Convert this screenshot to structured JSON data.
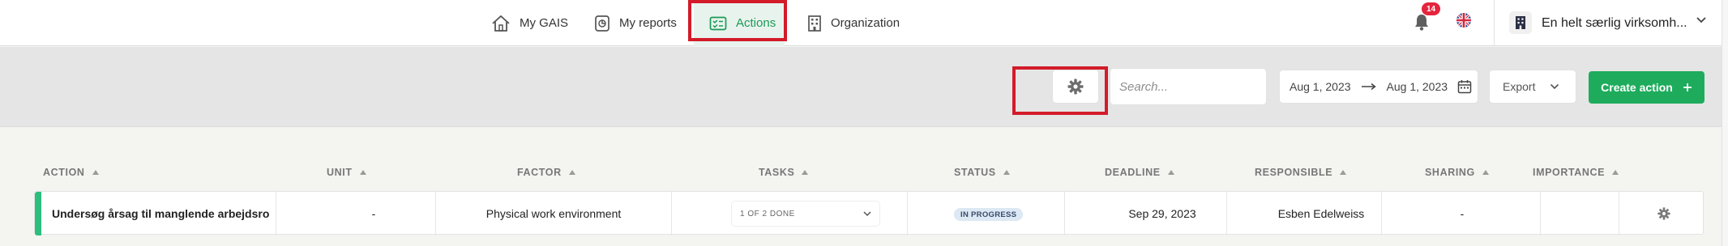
{
  "nav": {
    "items": [
      {
        "label": "My GAIS",
        "icon": "home-icon"
      },
      {
        "label": "My reports",
        "icon": "reports-icon"
      },
      {
        "label": "Actions",
        "icon": "actions-icon",
        "active": true
      },
      {
        "label": "Organization",
        "icon": "building-icon"
      }
    ]
  },
  "header": {
    "notification_count": "14",
    "language_icon": "uk-flag-icon",
    "organization_name": "En helt særlig virksomh..."
  },
  "toolbar": {
    "settings_icon": "gear-icon",
    "search_placeholder": "Search...",
    "date_from": "Aug 1, 2023",
    "date_to": "Aug 1, 2023",
    "export_label": "Export",
    "create_label": "Create action"
  },
  "table": {
    "columns": [
      "ACTION",
      "UNIT",
      "FACTOR",
      "TASKS",
      "STATUS",
      "DEADLINE",
      "RESPONSIBLE",
      "SHARING",
      "IMPORTANCE"
    ],
    "rows": [
      {
        "action": "Undersøg årsag til manglende arbejdsro",
        "unit": "-",
        "factor": "Physical work environment",
        "tasks": "1 OF 2 DONE",
        "status": "IN PROGRESS",
        "deadline": "Sep 29, 2023",
        "responsible": "Esben Edelweiss",
        "sharing": "-",
        "importance": ""
      }
    ]
  },
  "colors": {
    "accent": "#1eac5c",
    "active_nav_bg": "#e9f3ee",
    "highlight_box": "#d31b2a",
    "badge": "#e5243d",
    "status_pill": "#dce8f4"
  }
}
